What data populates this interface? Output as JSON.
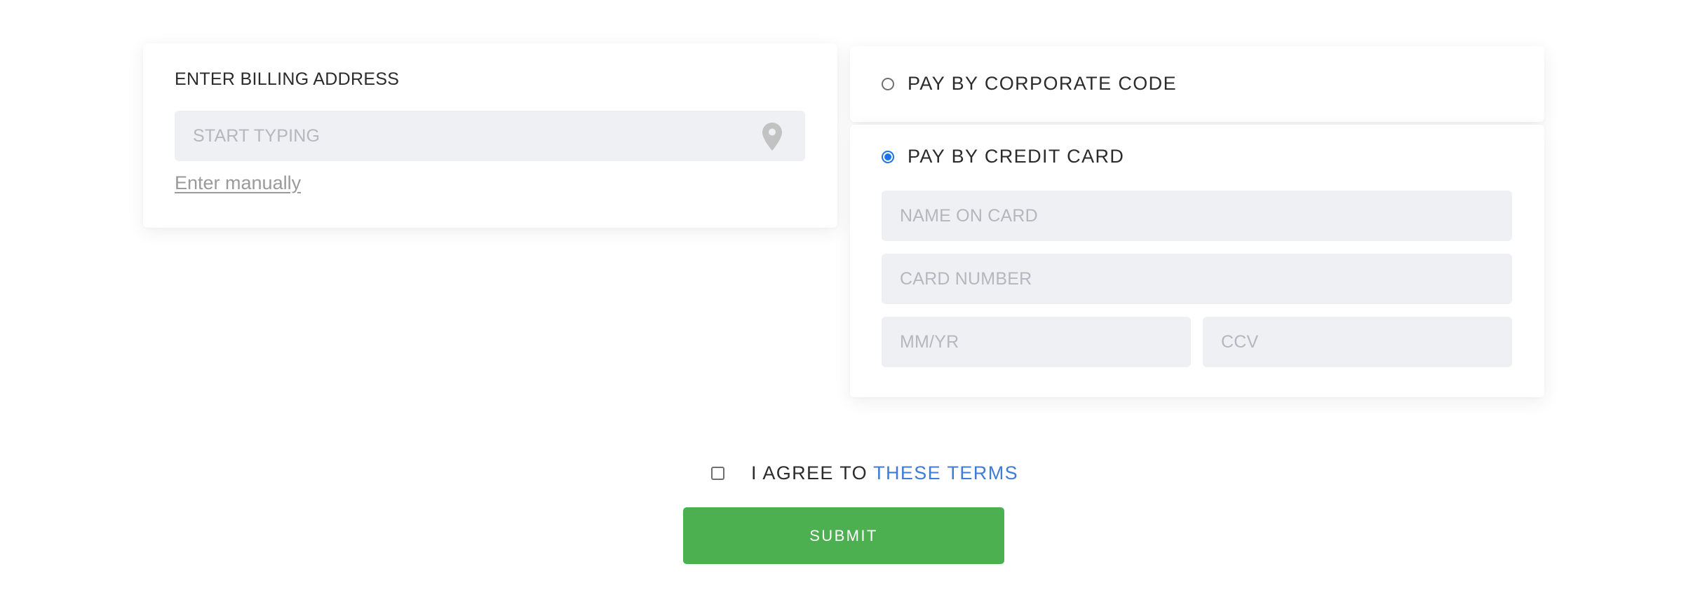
{
  "billing": {
    "title": "ENTER BILLING ADDRESS",
    "address_placeholder": "START TYPING",
    "address_value": "",
    "location_icon": "map-pin-icon",
    "manual_link": "Enter manually"
  },
  "payment": {
    "corporate": {
      "label": "PAY BY CORPORATE CODE",
      "selected": false
    },
    "credit_card": {
      "label": "PAY BY CREDIT CARD",
      "selected": true,
      "name_placeholder": "NAME ON CARD",
      "number_placeholder": "CARD NUMBER",
      "expiry_placeholder": "MM/YR",
      "ccv_placeholder": "CCV"
    }
  },
  "agreement": {
    "text": "I AGREE TO",
    "link": "THESE TERMS",
    "checked": false
  },
  "submit": {
    "label": "SUBMIT"
  },
  "colors": {
    "accent_blue": "#1a73e8",
    "link_blue": "#3f7bd8",
    "submit_green": "#4caf50",
    "field_background": "#eef0f4"
  }
}
